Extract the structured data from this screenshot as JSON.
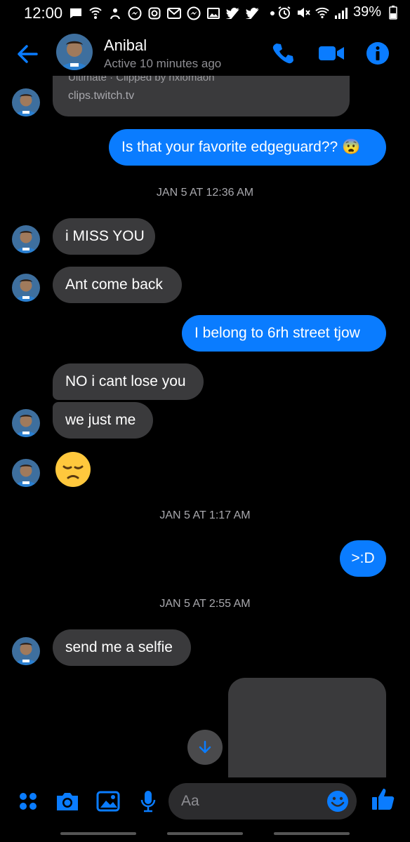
{
  "status_bar": {
    "time": "12:00",
    "battery": "39%"
  },
  "header": {
    "contact_name": "Anibal",
    "contact_status": "Active 10 minutes ago",
    "accent": "#0a7cff"
  },
  "link_card": {
    "sub": "Ultimate · Clipped by nxiomaon",
    "domain": "clips.twitch.tv"
  },
  "messages": [
    {
      "text": "Is that your favorite edgeguard?? 😨"
    },
    {
      "text": "JAN 5 AT 12:36 AM"
    },
    {
      "text": "i MISS YOU"
    },
    {
      "text": "Ant come back"
    },
    {
      "text": "I belong to 6rh street tjow"
    },
    {
      "text": "NO i cant lose you"
    },
    {
      "text": "we just me"
    },
    {
      "text": "😞"
    },
    {
      "text": "JAN 5 AT 1:17 AM"
    },
    {
      "text": ">:D"
    },
    {
      "text": "JAN 5 AT 2:55 AM"
    },
    {
      "text": "send me a selfie"
    }
  ],
  "composer": {
    "placeholder": "Aa"
  }
}
